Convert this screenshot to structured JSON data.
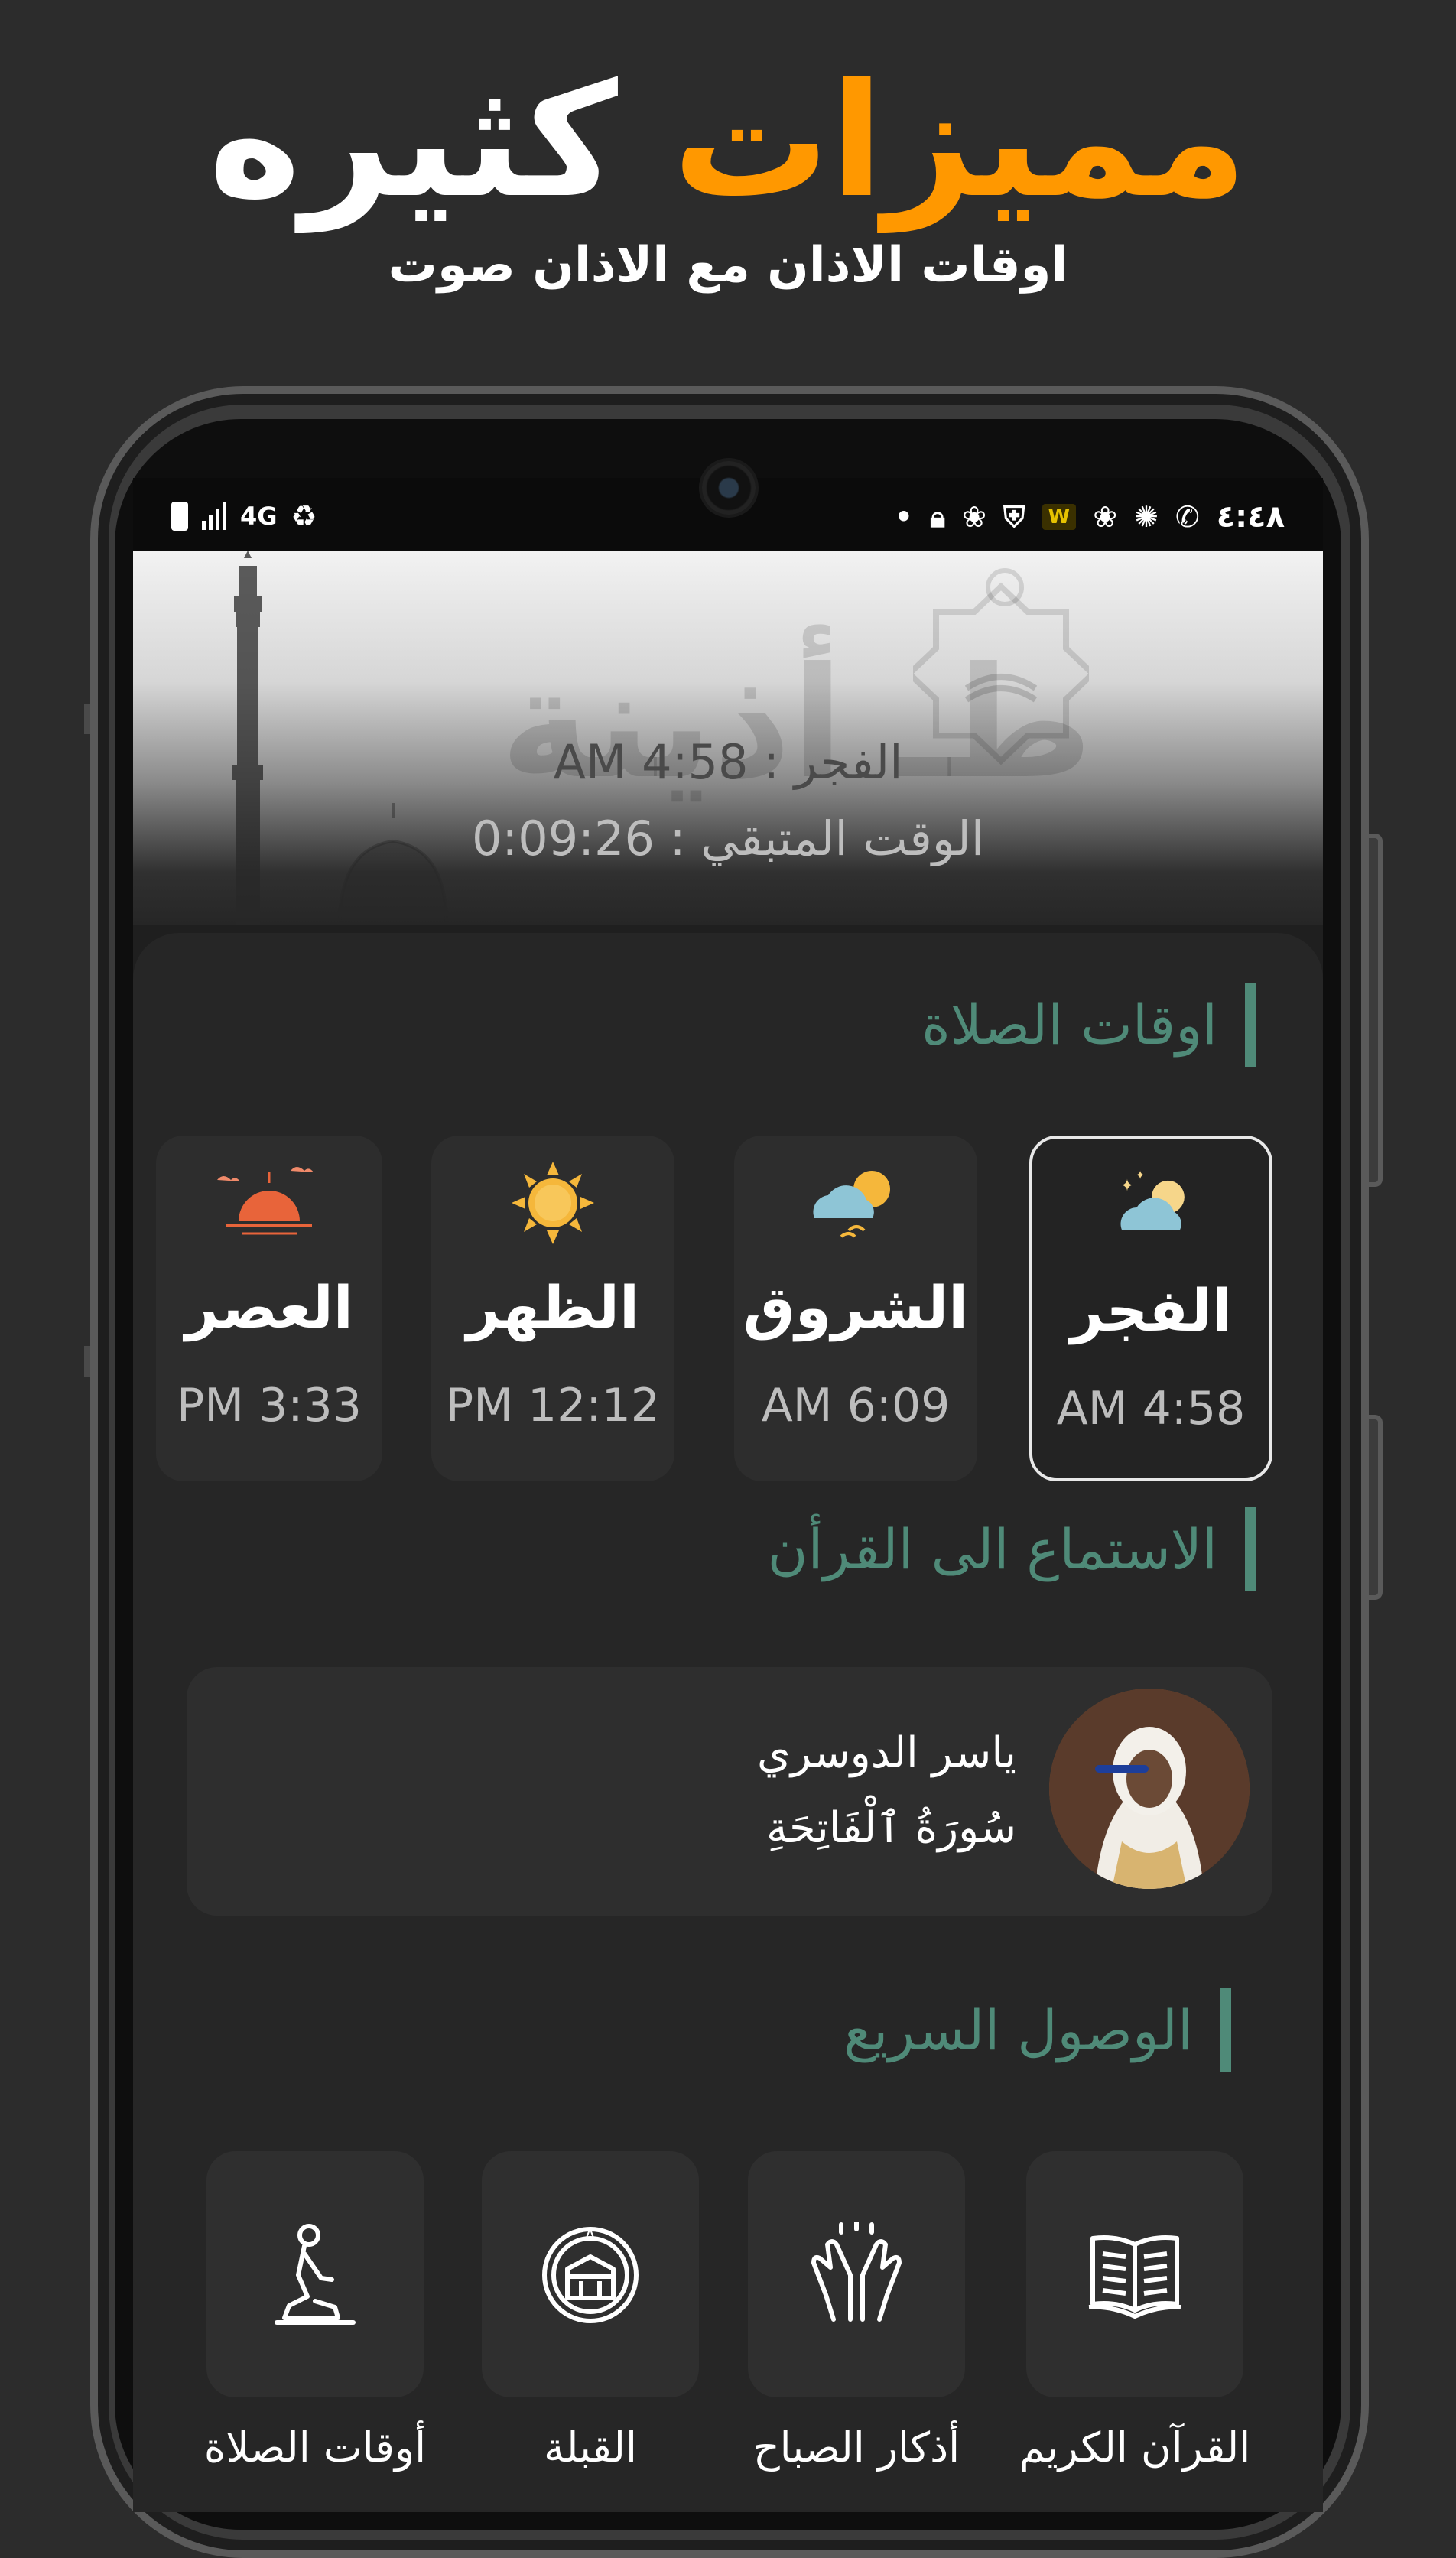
{
  "promo": {
    "title_accent": "مميزات",
    "title_rest": "كثيره",
    "subtitle": "اوقات الاذان مع الاذان صوت"
  },
  "status_bar": {
    "time": "٤:٤٨",
    "network": "4G"
  },
  "hero": {
    "watermark": "طـ أذينة",
    "next_prayer": "الفجر : AM 4:58",
    "remaining": "الوقت المتبقي : 0:09:26"
  },
  "sections": {
    "prayer_times": "اوقات الصلاة",
    "listen_quran": "الاستماع الى القرأن",
    "quick_access": "الوصول السريع"
  },
  "prayers": [
    {
      "name": "الفجر",
      "time": "AM 4:58",
      "icon": "night-moon-cloud-icon",
      "active": true
    },
    {
      "name": "الشروق",
      "time": "AM 6:09",
      "icon": "sun-cloud-icon",
      "active": false
    },
    {
      "name": "الظهر",
      "time": "PM 12:12",
      "icon": "sun-icon",
      "active": false
    },
    {
      "name": "العصر",
      "time": "PM 3:33",
      "icon": "sunset-icon",
      "active": false
    }
  ],
  "player": {
    "reciter": "ياسر الدوسري",
    "surah": "سُورَةُ ٱلْفَاتِحَةِ"
  },
  "quick_access": [
    {
      "label": "القرآن الكريم",
      "icon": "quran-book-icon"
    },
    {
      "label": "أذكار الصباح",
      "icon": "praying-hands-icon"
    },
    {
      "label": "القبلة",
      "icon": "qibla-compass-icon"
    },
    {
      "label": "أوقات الصلاة",
      "icon": "praying-person-icon"
    }
  ],
  "colors": {
    "accent_orange": "#ff9800",
    "section_green": "#4f8a78",
    "background": "#2c2c2c"
  }
}
